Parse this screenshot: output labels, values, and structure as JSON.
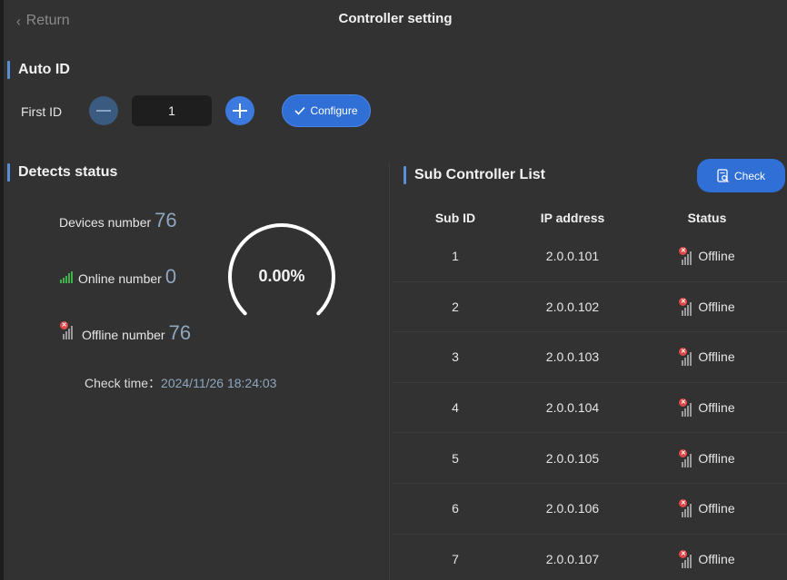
{
  "header": {
    "return_label": "Return",
    "title": "Controller setting"
  },
  "auto_id": {
    "title": "Auto ID",
    "first_id_label": "First ID",
    "first_id_value": "1",
    "configure_label": "Configure"
  },
  "detects": {
    "title": "Detects status",
    "devices_label": "Devices number",
    "devices_value": "76",
    "online_label": "Online number",
    "online_value": "0",
    "offline_label": "Offline number",
    "offline_value": "76",
    "check_time_label": "Check time：",
    "check_time_value": "2024/11/26 18:24:03",
    "online_percent": "0.00%",
    "online_fraction": 0
  },
  "sub_list": {
    "title": "Sub Controller List",
    "check_label": "Check",
    "columns": {
      "sub_id": "Sub ID",
      "ip": "IP address",
      "status": "Status"
    },
    "rows": [
      {
        "sub_id": "1",
        "ip": "2.0.0.101",
        "status": "Offline"
      },
      {
        "sub_id": "2",
        "ip": "2.0.0.102",
        "status": "Offline"
      },
      {
        "sub_id": "3",
        "ip": "2.0.0.103",
        "status": "Offline"
      },
      {
        "sub_id": "4",
        "ip": "2.0.0.104",
        "status": "Offline"
      },
      {
        "sub_id": "5",
        "ip": "2.0.0.105",
        "status": "Offline"
      },
      {
        "sub_id": "6",
        "ip": "2.0.0.106",
        "status": "Offline"
      },
      {
        "sub_id": "7",
        "ip": "2.0.0.107",
        "status": "Offline"
      }
    ]
  },
  "icons": {
    "back": "chevron-left-icon",
    "minus": "minus-icon",
    "plus": "plus-icon",
    "configure": "check-mark-icon",
    "online": "signal-bars-icon",
    "offline": "offline-signal-icon",
    "check": "search-document-icon"
  },
  "colors": {
    "accent": "#2f6fd6",
    "value_text": "#8fa6bf",
    "online": "#3fb24a",
    "offline": "#e04848",
    "background": "#323232"
  }
}
